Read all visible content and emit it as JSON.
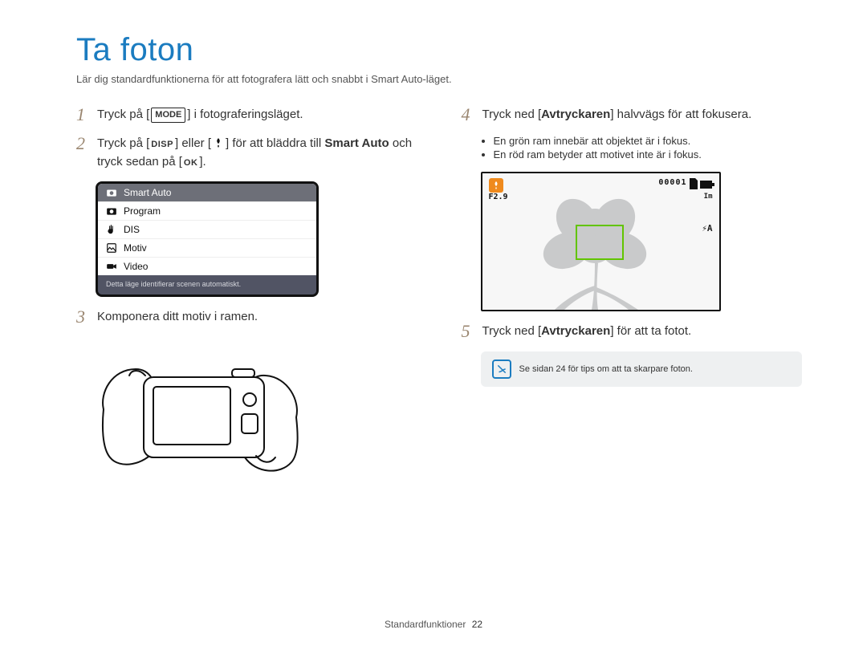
{
  "page": {
    "title": "Ta foton",
    "subtitle": "Lär dig standardfunktionerna för att fotografera lätt och snabbt i Smart Auto-läget."
  },
  "steps": {
    "s1": {
      "num": "1",
      "pre": "Tryck på [",
      "mode_label": "MODE",
      "post": "] i fotograferingsläget."
    },
    "s2": {
      "num": "2",
      "pre": "Tryck på [",
      "disp_label": "DISP",
      "mid": "] eller [",
      "macro_alt": "macro-icon",
      "post1": "] för att bläddra till ",
      "smart_auto": "Smart Auto",
      "post2": " och tryck sedan på [",
      "ok_label": "OK",
      "post3": "]."
    },
    "s3": {
      "num": "3",
      "text": "Komponera ditt motiv i ramen."
    },
    "s4": {
      "num": "4",
      "pre": "Tryck ned [",
      "shutter": "Avtryckaren",
      "post": "] halvvägs för att fokusera."
    },
    "s5": {
      "num": "5",
      "pre": "Tryck ned [",
      "shutter": "Avtryckaren",
      "post": "] för att ta fotot."
    }
  },
  "bullets": {
    "b1": "En grön ram innebär att objektet är i fokus.",
    "b2": "En röd ram betyder att motivet inte är i fokus."
  },
  "mode_menu": {
    "items": [
      {
        "icon": "camera-auto-icon",
        "label": "Smart Auto",
        "selected": true
      },
      {
        "icon": "camera-p-icon",
        "label": "Program",
        "selected": false
      },
      {
        "icon": "hand-icon",
        "label": "DIS",
        "selected": false
      },
      {
        "icon": "scene-icon",
        "label": "Motiv",
        "selected": false
      },
      {
        "icon": "video-icon",
        "label": "Video",
        "selected": false
      }
    ],
    "caption": "Detta läge identifierar scenen automatiskt."
  },
  "focus_screen": {
    "counter": "00001",
    "fnumber": "F2.9",
    "size": "Im",
    "flash": "⚡A"
  },
  "tip": {
    "text": "Se sidan 24 för tips om att ta skarpare foton."
  },
  "footer": {
    "section": "Standardfunktioner",
    "page_number": "22"
  }
}
